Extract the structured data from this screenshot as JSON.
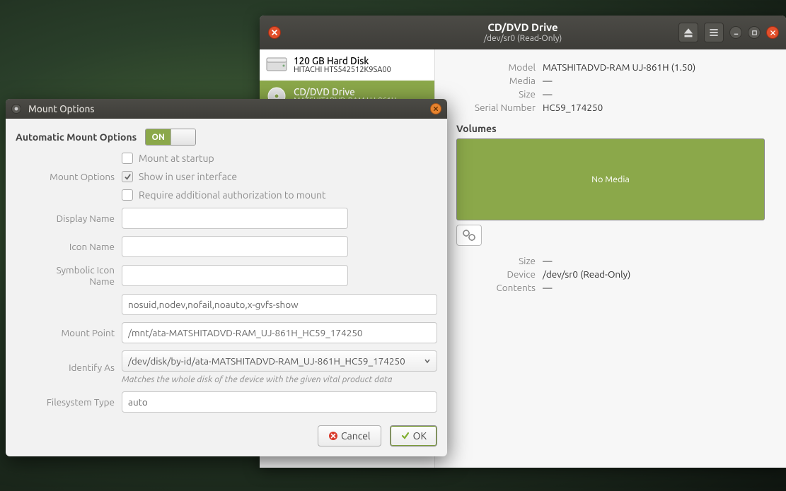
{
  "disks_window": {
    "title": "CD/DVD Drive",
    "subtitle": "/dev/sr0 (Read-Only)",
    "devices": [
      {
        "name": "120 GB Hard Disk",
        "sub": "HITACHI HTS542512K9SA00"
      },
      {
        "name": "CD/DVD Drive",
        "sub": "MATSHITADVD-RAM UJ-861H"
      }
    ],
    "details": {
      "model_label": "Model",
      "model": "MATSHITADVD-RAM UJ-861H (1.50)",
      "media_label": "Media",
      "media": "—",
      "size_label": "Size",
      "size": "—",
      "serial_label": "Serial Number",
      "serial": "HC59_174250"
    },
    "volumes_label": "Volumes",
    "no_media": "No Media",
    "volume_details": {
      "size_label": "Size",
      "size": "—",
      "device_label": "Device",
      "device": "/dev/sr0 (Read-Only)",
      "contents_label": "Contents",
      "contents": "—"
    }
  },
  "dialog": {
    "title": "Mount Options",
    "automatic_label": "Automatic Mount Options",
    "switch_on_text": "ON",
    "mount_options_label": "Mount Options",
    "cb_startup": "Mount at startup",
    "cb_show_ui": "Show in user interface",
    "cb_auth": "Require additional authorization to mount",
    "display_name_label": "Display Name",
    "icon_name_label": "Icon Name",
    "sym_icon_label": "Symbolic Icon Name",
    "options_value": "nosuid,nodev,nofail,noauto,x-gvfs-show",
    "mount_point_label": "Mount Point",
    "mount_point_value": "/mnt/ata-MATSHITADVD-RAM_UJ-861H_HC59_174250",
    "identify_label": "Identify As",
    "identify_value": "/dev/disk/by-id/ata-MATSHITADVD-RAM_UJ-861H_HC59_174250",
    "identify_hint": "Matches the whole disk of the device with the given vital product data",
    "fs_type_label": "Filesystem Type",
    "fs_type_value": "auto",
    "cancel": "Cancel",
    "ok": "OK"
  }
}
